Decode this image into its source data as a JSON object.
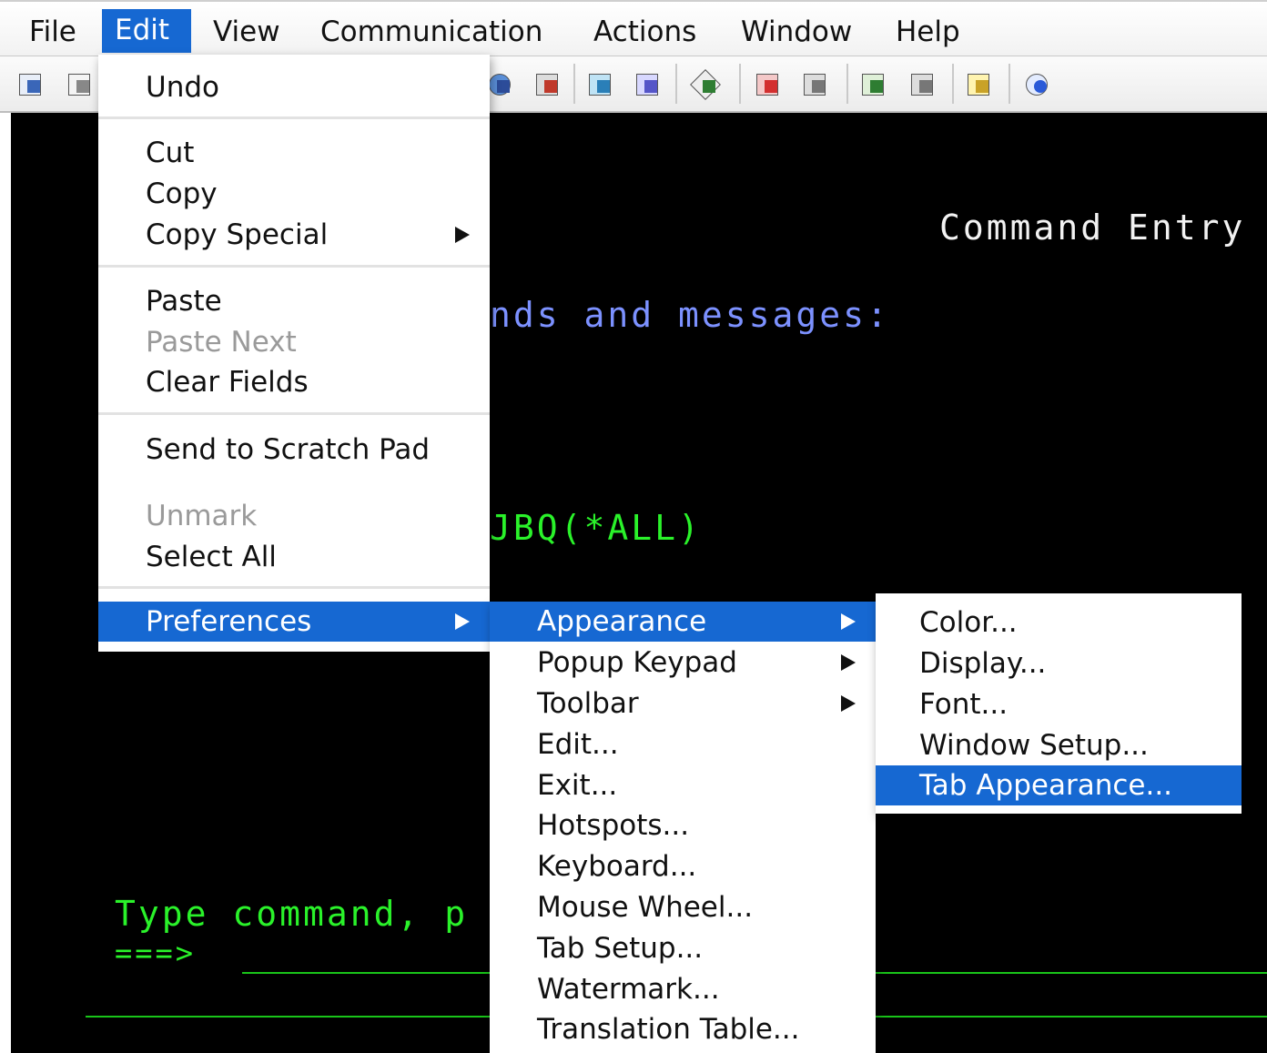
{
  "menubar": {
    "items": [
      "File",
      "Edit",
      "View",
      "Communication",
      "Actions",
      "Window",
      "Help"
    ]
  },
  "terminal": {
    "title": "Command Entry",
    "messages_line": "nds and messages:",
    "command_text": "JBQ(*ALL)",
    "prompt_line": "Type command, p",
    "arrow": "===>"
  },
  "edit_menu": {
    "items": [
      {
        "label": "Undo",
        "enabled": true
      },
      {
        "label": "Cut",
        "enabled": true
      },
      {
        "label": "Copy",
        "enabled": true
      },
      {
        "label": "Copy Special",
        "enabled": true,
        "submenu": true
      },
      {
        "label": "Paste",
        "enabled": true
      },
      {
        "label": "Paste Next",
        "enabled": false
      },
      {
        "label": "Clear Fields",
        "enabled": true
      },
      {
        "label": "Send to Scratch Pad",
        "enabled": true
      },
      {
        "label": "Unmark",
        "enabled": false
      },
      {
        "label": "Select All",
        "enabled": true
      },
      {
        "label": "Preferences",
        "enabled": true,
        "submenu": true,
        "highlighted": true
      }
    ]
  },
  "preferences_menu": {
    "items": [
      {
        "label": "Appearance",
        "submenu": true,
        "highlighted": true
      },
      {
        "label": "Popup Keypad",
        "submenu": true
      },
      {
        "label": "Toolbar",
        "submenu": true
      },
      {
        "label": "Edit..."
      },
      {
        "label": "Exit..."
      },
      {
        "label": "Hotspots..."
      },
      {
        "label": "Keyboard..."
      },
      {
        "label": "Mouse Wheel..."
      },
      {
        "label": "Tab Setup..."
      },
      {
        "label": "Watermark..."
      },
      {
        "label": "Translation Table..."
      }
    ]
  },
  "appearance_menu": {
    "items": [
      {
        "label": "Color..."
      },
      {
        "label": "Display..."
      },
      {
        "label": "Font..."
      },
      {
        "label": "Window Setup..."
      },
      {
        "label": "Tab Appearance...",
        "highlighted": true
      }
    ]
  },
  "colors": {
    "highlight": "#1668d2",
    "terminal_bg": "#000000",
    "terminal_green": "#2af22a",
    "terminal_blue": "#7c91ff"
  }
}
